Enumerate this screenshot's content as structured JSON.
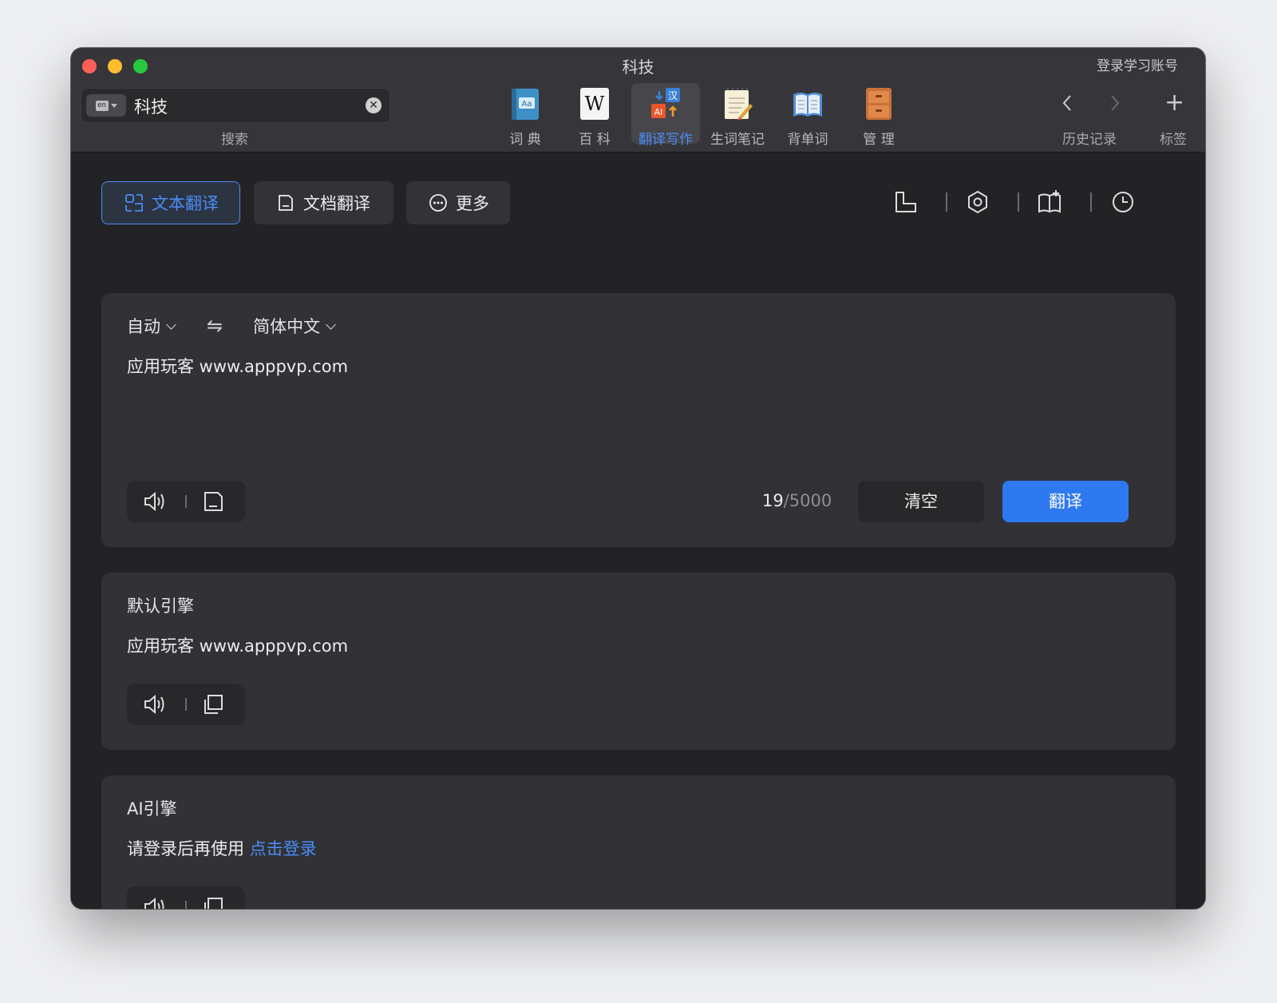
{
  "window": {
    "title": "科技",
    "login_link": "登录学习账号"
  },
  "search": {
    "lang_code": "en",
    "query": "科技",
    "label": "搜索"
  },
  "toolbar": {
    "items": [
      {
        "label": "词 典",
        "icon": "dictionary-icon"
      },
      {
        "label": "百 科",
        "icon": "wikipedia-icon"
      },
      {
        "label": "翻译写作",
        "icon": "translate-write-icon"
      },
      {
        "label": "生词笔记",
        "icon": "vocab-notes-icon"
      },
      {
        "label": "背单词",
        "icon": "memorize-words-icon"
      },
      {
        "label": "管 理",
        "icon": "manage-icon"
      }
    ],
    "active_index": 2
  },
  "nav": {
    "history_label": "历史记录",
    "tabs_label": "标签",
    "new_tab": "+"
  },
  "mode_tabs": [
    {
      "label": "文本翻译",
      "icon": "text-translate-icon",
      "active": true
    },
    {
      "label": "文档翻译",
      "icon": "document-translate-icon",
      "active": false
    },
    {
      "label": "更多",
      "icon": "more-icon",
      "active": false
    }
  ],
  "right_tools": [
    "layout-icon",
    "settings-icon",
    "wordbook-icon",
    "history-icon"
  ],
  "input_panel": {
    "source_lang": "自动",
    "swap_symbol": "⇋",
    "target_lang": "简体中文",
    "text": "应用玩客 www.apppvp.com",
    "char_count": "19",
    "char_max": "/5000",
    "clear_label": "清空",
    "translate_label": "翻译"
  },
  "results": [
    {
      "title": "默认引擎",
      "body": "应用玩客 www.apppvp.com"
    },
    {
      "title": "AI引擎",
      "body": "请登录后再使用",
      "login_cta": "点击登录"
    }
  ],
  "colors": {
    "accent": "#2f79f0",
    "accent_text": "#4a8cf5",
    "panel": "#323236",
    "background": "#232326"
  }
}
